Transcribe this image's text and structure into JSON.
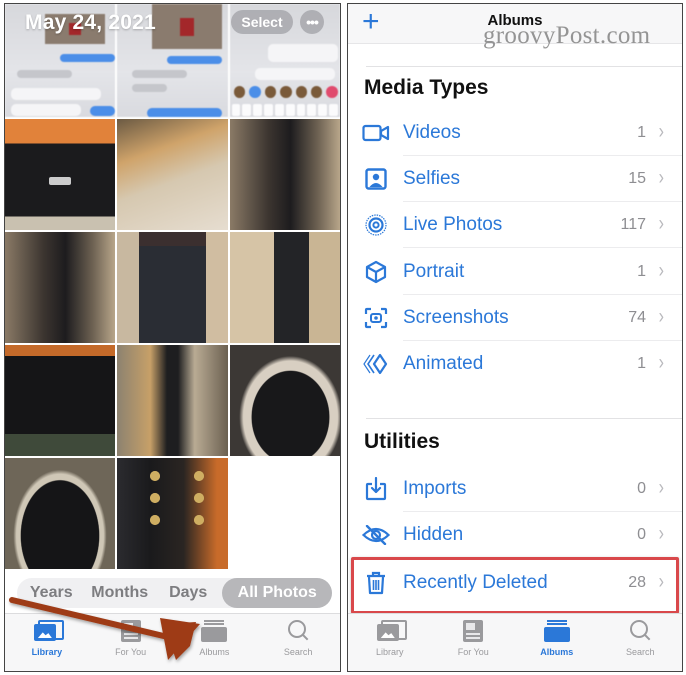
{
  "library_screen": {
    "date_title": "May 24, 2021",
    "select_button": "Select",
    "more_button": "•••",
    "photos": [
      {
        "subject": "orange amplifier"
      },
      {
        "subject": "acoustic guitar and amp"
      },
      {
        "subject": "black bass guitar"
      },
      {
        "subject": "black bass guitar"
      },
      {
        "subject": "guitar case"
      },
      {
        "subject": "guitar stand"
      },
      {
        "subject": "orange amplifier"
      },
      {
        "subject": "les paul guitar with amp"
      },
      {
        "subject": "les paul guitar body"
      },
      {
        "subject": "les paul guitar body"
      },
      {
        "subject": "guitar headstock"
      }
    ],
    "segmented_control": {
      "items": [
        "Years",
        "Months",
        "Days",
        "All Photos"
      ],
      "selected": "All Photos"
    },
    "tab_bar": {
      "items": [
        {
          "label": "Library",
          "icon": "photo-library-icon",
          "active": true
        },
        {
          "label": "For You",
          "icon": "for-you-icon",
          "active": false
        },
        {
          "label": "Albums",
          "icon": "albums-icon",
          "active": false
        },
        {
          "label": "Search",
          "icon": "search-icon",
          "active": false
        }
      ]
    },
    "annotation": {
      "type": "arrow",
      "points_to": "Albums",
      "color": "#9e3b16"
    }
  },
  "albums_screen": {
    "nav_title": "Albums",
    "add_button": "+",
    "watermark": "groovyPost.com",
    "sections": [
      {
        "title": "Media Types",
        "rows": [
          {
            "label": "Videos",
            "count": "1",
            "icon": "video-camera-icon"
          },
          {
            "label": "Selfies",
            "count": "15",
            "icon": "selfie-portrait-icon"
          },
          {
            "label": "Live Photos",
            "count": "117",
            "icon": "live-photo-icon"
          },
          {
            "label": "Portrait",
            "count": "1",
            "icon": "cube-icon"
          },
          {
            "label": "Screenshots",
            "count": "74",
            "icon": "screenshot-icon"
          },
          {
            "label": "Animated",
            "count": "1",
            "icon": "animated-icon"
          }
        ]
      },
      {
        "title": "Utilities",
        "rows": [
          {
            "label": "Imports",
            "count": "0",
            "icon": "import-tray-icon"
          },
          {
            "label": "Hidden",
            "count": "0",
            "icon": "eye-slash-icon"
          },
          {
            "label": "Recently Deleted",
            "count": "28",
            "icon": "trash-icon",
            "highlighted": true
          }
        ]
      }
    ],
    "chevron": "›",
    "tab_bar": {
      "items": [
        {
          "label": "Library",
          "icon": "photo-library-icon",
          "active": false
        },
        {
          "label": "For You",
          "icon": "for-you-icon",
          "active": false
        },
        {
          "label": "Albums",
          "icon": "albums-icon",
          "active": true
        },
        {
          "label": "Search",
          "icon": "search-icon",
          "active": false
        }
      ]
    },
    "highlight_color": "#d9484b"
  },
  "colors": {
    "accent": "#2b78d8",
    "count_gray": "#8e8e92",
    "tab_inactive": "#9a9a9d"
  }
}
